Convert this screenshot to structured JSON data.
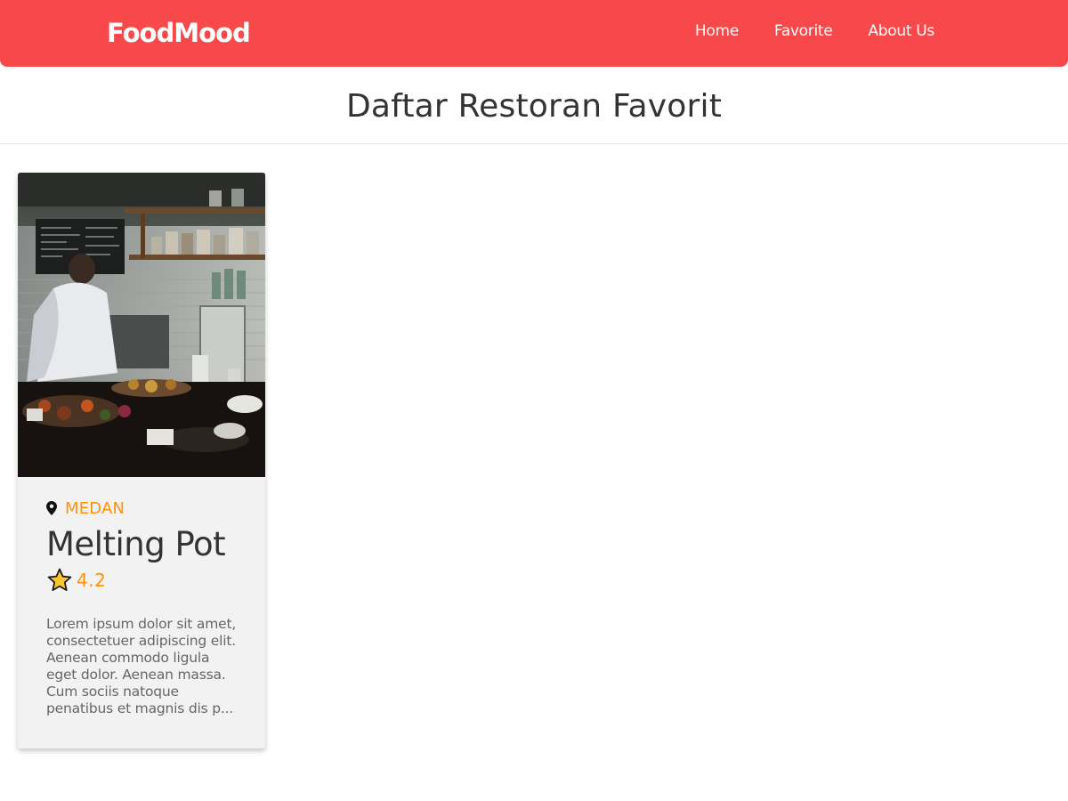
{
  "header": {
    "brand": "FoodMood",
    "nav": [
      {
        "label": "Home"
      },
      {
        "label": "Favorite"
      },
      {
        "label": "About Us"
      }
    ],
    "accent_color": "#f7494b"
  },
  "main": {
    "title": "Daftar Restoran Favorit",
    "restaurants": [
      {
        "city": "MEDAN",
        "name": "Melting Pot",
        "rating": "4.2",
        "description": "Lorem ipsum dolor sit amet, consectetuer adipiscing elit. Aenean commodo ligula eget dolor. Aenean massa. Cum sociis natoque penatibus et magnis dis p...",
        "location_icon": "map-pin-icon",
        "rating_icon": "star-icon",
        "image": "restaurant-kitchen-photo"
      }
    ]
  },
  "colors": {
    "city": "#ff9209",
    "rating": "#ff9209",
    "card_background": "#f2f2f2",
    "star_fill": "#fcc52f"
  }
}
